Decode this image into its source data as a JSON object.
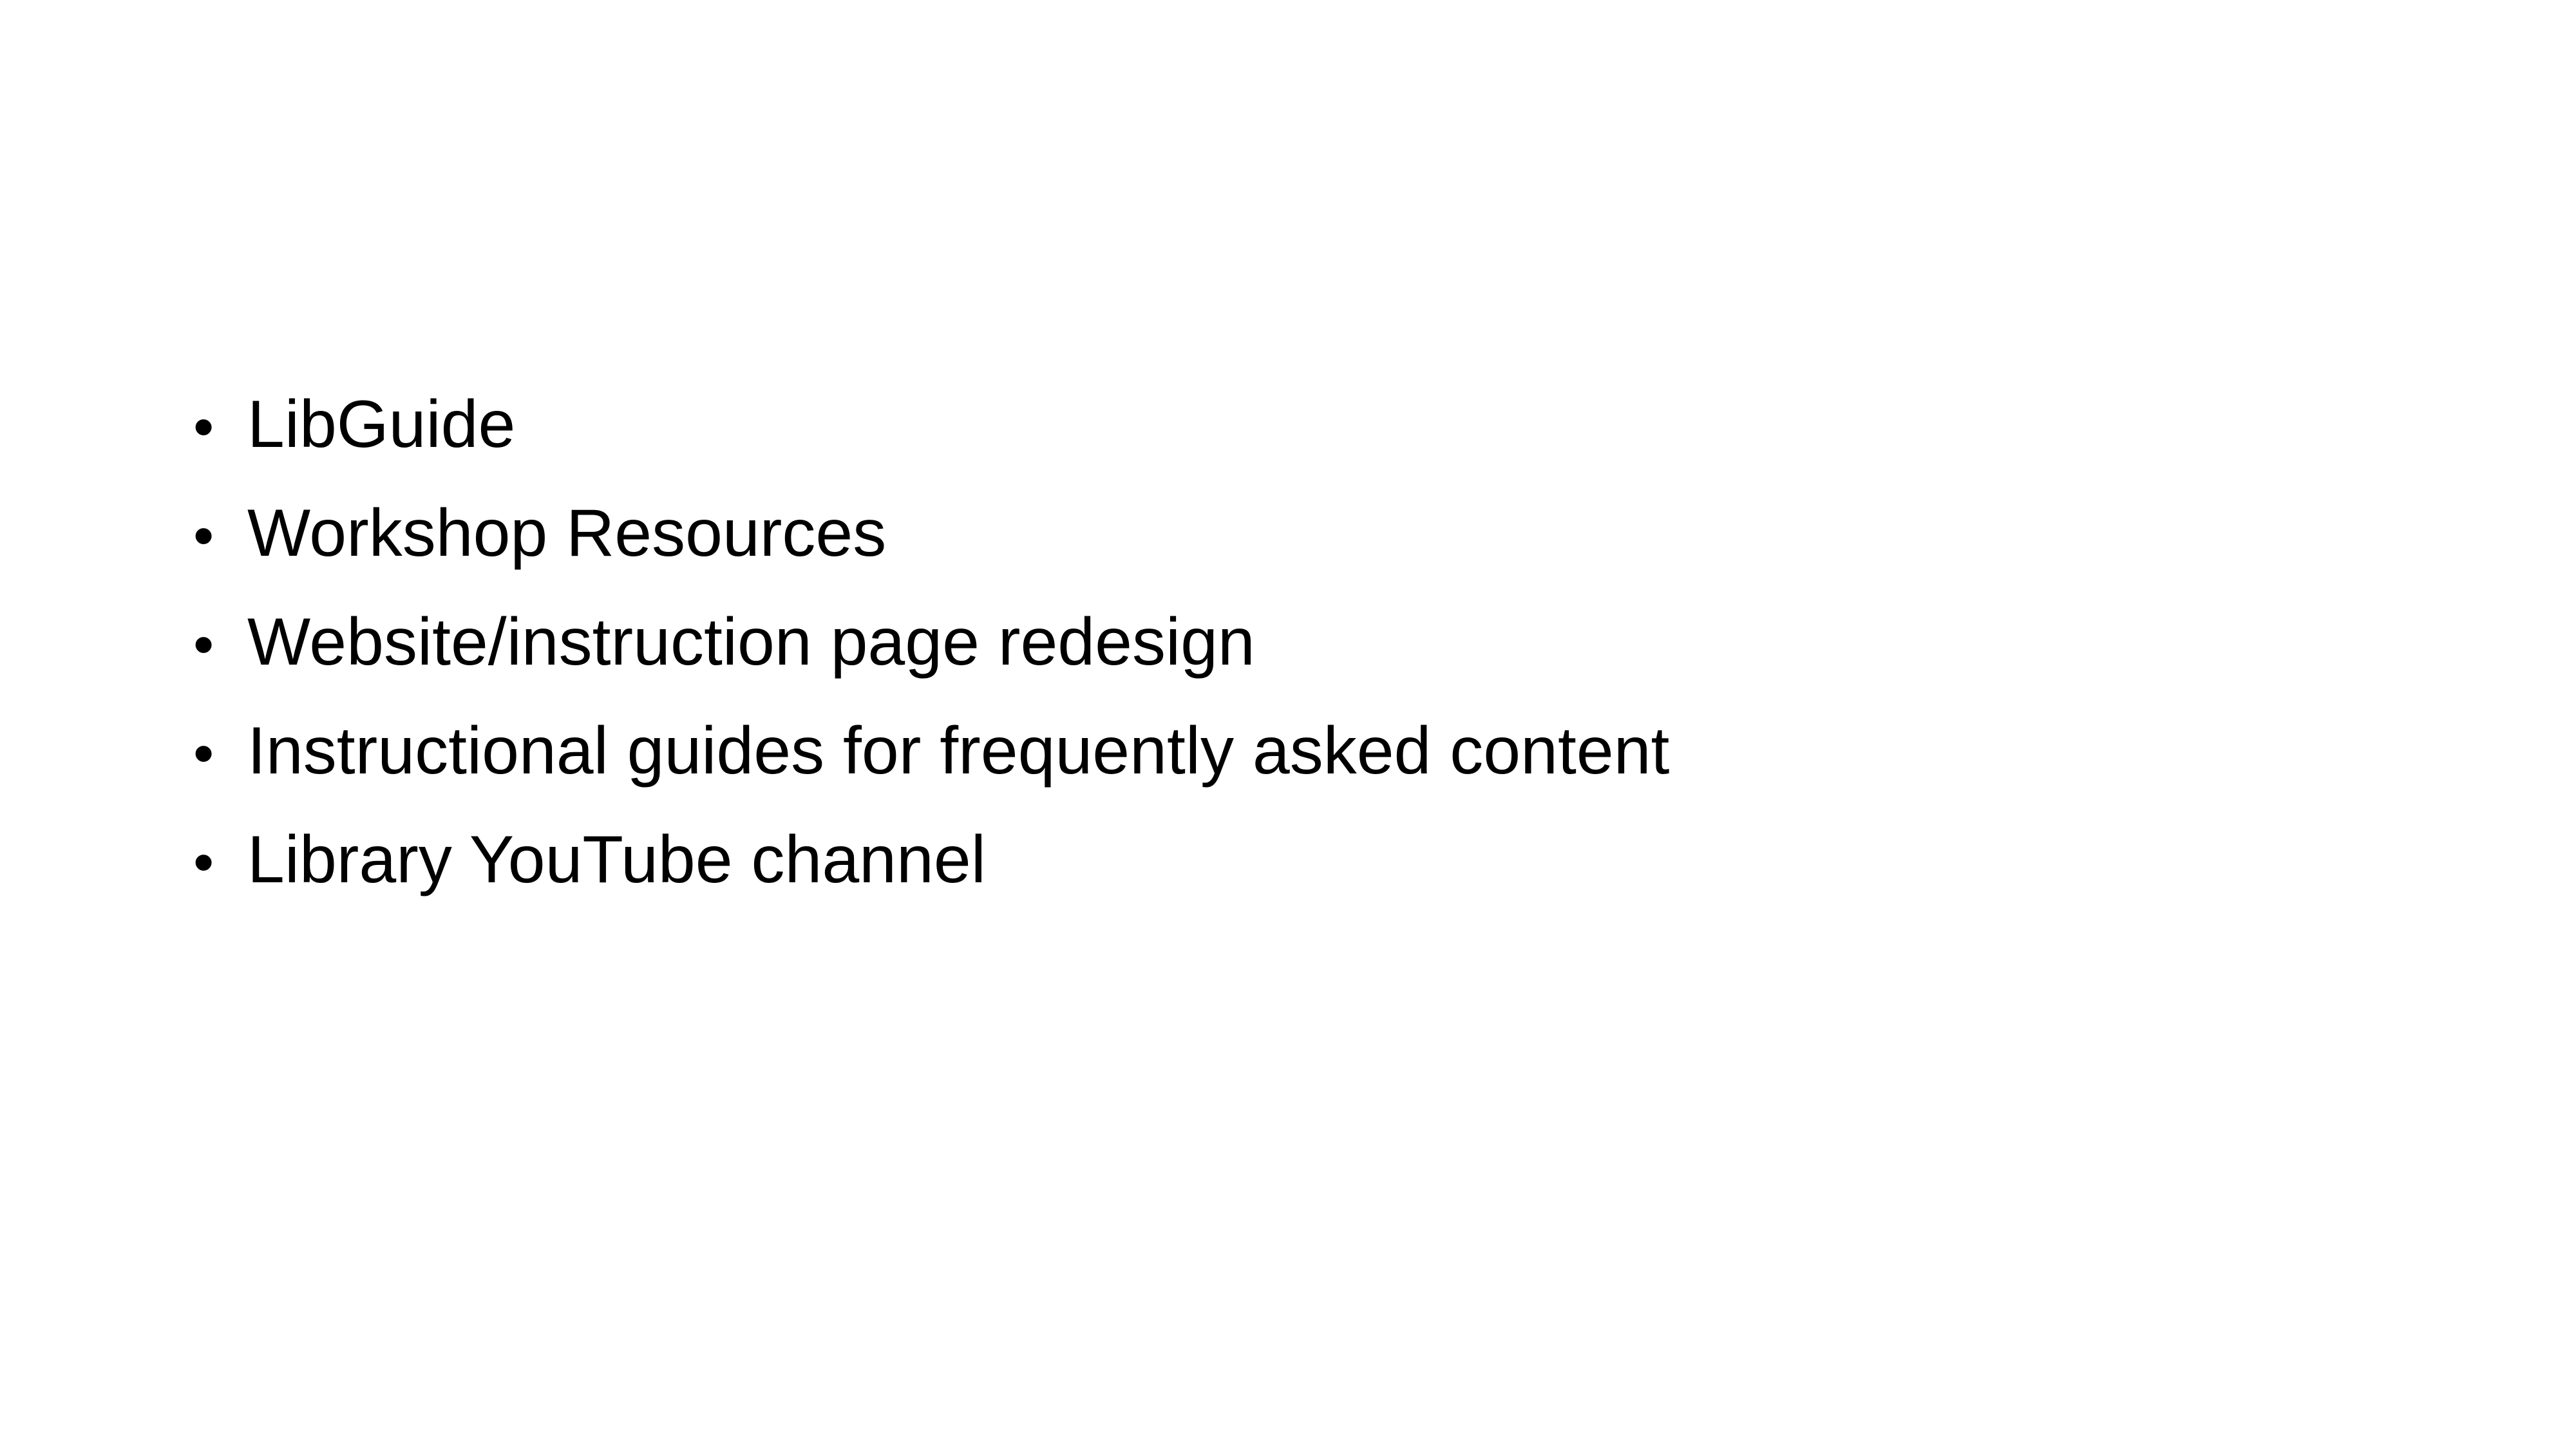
{
  "slide": {
    "bullets": [
      "LibGuide",
      "Workshop Resources",
      "Website/instruction page redesign",
      "Instructional guides for frequently asked content",
      "Library YouTube channel"
    ],
    "bullet_glyph": "•",
    "colors": {
      "background": "#ffffff",
      "text": "#000000"
    }
  }
}
